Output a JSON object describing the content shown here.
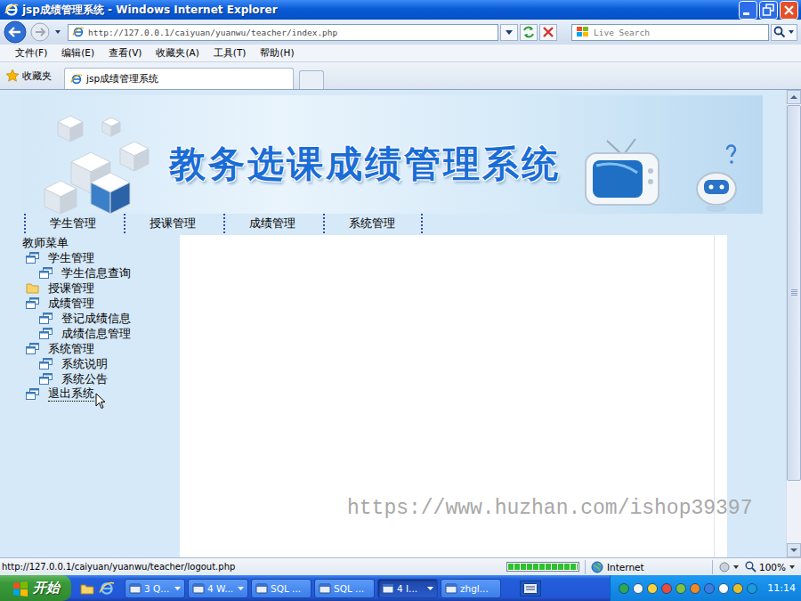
{
  "window": {
    "title": "jsp成绩管理系统 - Windows Internet Explorer"
  },
  "address_bar": {
    "url": "http://127.0.0.1/caiyuan/yuanwu/teacher/index.php"
  },
  "search": {
    "placeholder": "Live Search"
  },
  "menu_bar": [
    "文件(F)",
    "编辑(E)",
    "查看(V)",
    "收藏夹(A)",
    "工具(T)",
    "帮助(H)"
  ],
  "favorites": {
    "label": "收藏夹"
  },
  "tabs": [
    {
      "label": "jsp成绩管理系统",
      "selected": true
    }
  ],
  "page": {
    "banner_title": "教务选课成绩管理系统",
    "nav": [
      "学生管理",
      "授课管理",
      "成绩管理",
      "系统管理"
    ],
    "sidebar": {
      "title": "教师菜单",
      "items": [
        {
          "label": "学生管理",
          "kind": "node",
          "hovered": false,
          "children": [
            {
              "label": "学生信息查询"
            }
          ]
        },
        {
          "label": "授课管理",
          "kind": "folder",
          "hovered": false,
          "children": []
        },
        {
          "label": "成绩管理",
          "kind": "node",
          "hovered": false,
          "children": [
            {
              "label": "登记成绩信息"
            },
            {
              "label": "成绩信息管理"
            }
          ]
        },
        {
          "label": "系统管理",
          "kind": "node",
          "hovered": false,
          "children": [
            {
              "label": "系统说明"
            },
            {
              "label": "系统公告"
            }
          ]
        },
        {
          "label": "退出系统",
          "kind": "node",
          "hovered": true,
          "children": []
        }
      ]
    },
    "watermark": "https://www.huzhan.com/ishop39397"
  },
  "status_bar": {
    "text": "http://127.0.0.1/caiyuan/yuanwu/teacher/logout.php",
    "progress": {
      "level": 1
    },
    "zone": "Internet",
    "zoom": "100%"
  },
  "taskbar": {
    "start": "开始",
    "tasks": [
      {
        "label": "3 Q...",
        "grouped": true,
        "selected": false
      },
      {
        "label": "4 W...",
        "grouped": true,
        "selected": false
      },
      {
        "label": "SQL ...",
        "grouped": false,
        "selected": false
      },
      {
        "label": "SQL ...",
        "grouped": false,
        "selected": false
      },
      {
        "label": "4 I...",
        "grouped": true,
        "selected": true
      },
      {
        "label": "zhgl...",
        "grouped": false,
        "selected": false
      }
    ],
    "clock": "11:14"
  }
}
